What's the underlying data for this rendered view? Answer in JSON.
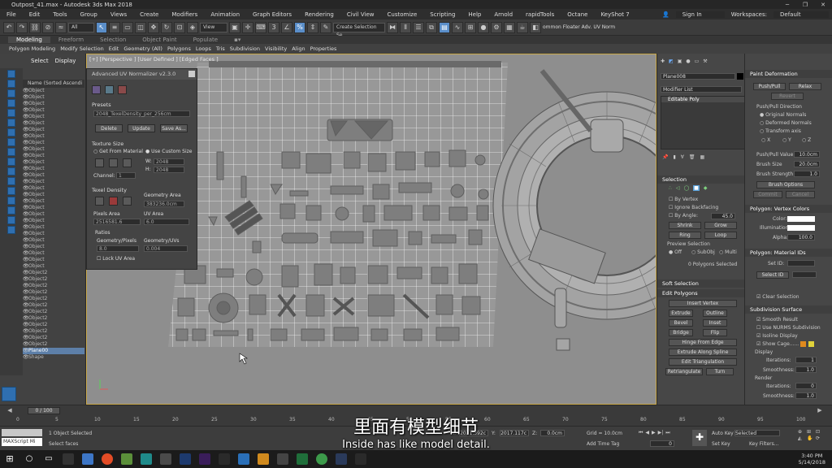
{
  "window": {
    "title": "Outpost_41.max - Autodesk 3ds Max 2018"
  },
  "menu": [
    "File",
    "Edit",
    "Tools",
    "Group",
    "Views",
    "Create",
    "Modifiers",
    "Animation",
    "Graph Editors",
    "Rendering",
    "Civil View",
    "Customize",
    "Scripting",
    "Help",
    "Arnold",
    "rapidTools",
    "Octane",
    "KeyShot 7"
  ],
  "account": {
    "sign_in": "Sign In",
    "workspaces_label": "Workspaces:",
    "workspace": "Default"
  },
  "toolbar": {
    "filter": "All",
    "view": "View",
    "selection_set": "Create Selection Se",
    "floater": "ommon Floater Adv. UV Norm"
  },
  "ribbon": {
    "tabs": [
      "Modeling",
      "Freeform",
      "Selection",
      "Object Paint",
      "Populate"
    ],
    "items": [
      "Polygon Modeling",
      "Modify Selection",
      "Edit",
      "Geometry (All)",
      "Polygons",
      "Loops",
      "Tris",
      "Subdivision",
      "Visibility",
      "Align",
      "Properties"
    ]
  },
  "explorer": {
    "tabs": [
      "Select",
      "Display"
    ],
    "header": "Name (Sorted Ascendi",
    "rows": [
      "Object",
      "Object",
      "Object",
      "Object",
      "Object",
      "Object",
      "Object",
      "Object",
      "Object",
      "Object",
      "Object",
      "Object",
      "Object",
      "Object",
      "Object",
      "Object",
      "Object",
      "Object",
      "Object",
      "Object",
      "Object",
      "Object",
      "Object",
      "Object",
      "Object",
      "Object",
      "Object",
      "Object",
      "Object2",
      "Object2",
      "Object2",
      "Object2",
      "Object2",
      "Object2",
      "Object2",
      "Object2",
      "Object2",
      "Object2",
      "Object2",
      "Object2",
      "Plane00",
      "Shape"
    ],
    "selected_row": "Plane00"
  },
  "viewport": {
    "label": "[+] [Perspective ] [User Defined ] [Edged Faces ]"
  },
  "uvtool": {
    "title": "Advanced UV Normalizer v2.3.0",
    "presets_label": "Presets",
    "preset_value": "2048_TexelDensity_per_256cm",
    "btn_delete": "Delete",
    "btn_update": "Update",
    "btn_saveas": "Save As...",
    "texture_size_label": "Texture Size",
    "get_from_material": "Get From Material",
    "use_custom_size": "Use Custom Size",
    "w_label": "W:",
    "w_value": "2048",
    "h_label": "H:",
    "h_value": "2048",
    "channel_label": "Channel:",
    "channel_value": "1",
    "texel_density_label": "Texel Density",
    "geometry_area_label": "Geometry Area",
    "geometry_area_value": "383236.0cm",
    "pixels_area_label": "Pixels Area",
    "pixels_area_value": "2516581.6",
    "uv_area_label": "UV Area",
    "uv_area_value": "6.0",
    "ratios_label": "Ratios",
    "geo_pixels_label": "Geometry/Pixels",
    "geo_pixels_value": "8.0",
    "geo_uvs_label": "Geometry/UVs",
    "geo_uvs_value": "0.004",
    "lock_uv_area": "Lock UV Area"
  },
  "command_panel": {
    "object_name": "Plane008",
    "modifier_list": "Modifier List",
    "stack_item": "Editable Poly",
    "selection_head": "Selection",
    "by_vertex": "By Vertex",
    "ignore_backfacing": "Ignore Backfacing",
    "by_angle": "By Angle:",
    "by_angle_value": "45.0",
    "shrink": "Shrink",
    "grow": "Grow",
    "ring": "Ring",
    "loop": "Loop",
    "preview_selection": "Preview Selection",
    "off": "Off",
    "subobj": "SubObj",
    "multi": "Multi",
    "polys_selected": "0 Polygons Selected",
    "soft_selection": "Soft Selection",
    "edit_polygons": "Edit Polygons",
    "insert_vertex": "Insert Vertex",
    "extrude": "Extrude",
    "outline": "Outline",
    "bevel": "Bevel",
    "inset": "Inset",
    "bridge": "Bridge",
    "flip": "Flip",
    "hinge_from_edge": "Hinge From Edge",
    "extrude_along_spline": "Extrude Along Spline",
    "edit_triangulation": "Edit Triangulation",
    "retriangulate": "Retriangulate",
    "turn": "Turn"
  },
  "mod_panel": {
    "paint_deformation": "Paint Deformation",
    "push_pull": "Push/Pull",
    "relax": "Relax",
    "revert": "Revert",
    "push_pull_direction": "Push/Pull Direction",
    "original_normals": "Original Normals",
    "deformed_normals": "Deformed Normals",
    "transform_axis": "Transform axis",
    "x": "X",
    "y": "Y",
    "z": "Z",
    "push_pull_value_label": "Push/Pull Value",
    "push_pull_value": "10.0cm",
    "brush_size_label": "Brush Size",
    "brush_size": "20.0cm",
    "brush_strength_label": "Brush Strength",
    "brush_strength": "1.0",
    "brush_options": "Brush Options",
    "commit": "Commit",
    "cancel": "Cancel",
    "vertex_colors_head": "Polygon: Vertex Colors",
    "color_label": "Color:",
    "illumination_label": "Illumination:",
    "alpha_label": "Alpha:",
    "alpha_value": "100.0",
    "material_ids_head": "Polygon: Material IDs",
    "set_id_label": "Set ID:",
    "select_id": "Select ID",
    "clear_selection": "Clear Selection",
    "subdivision_surface": "Subdivision Surface",
    "smooth_result": "Smooth Result",
    "use_nurms": "Use NURMS Subdivision",
    "isoline_display": "Isoline Display",
    "show_cage": "Show Cage......",
    "display_label": "Display",
    "iterations_label": "Iterations:",
    "iterations_value": "1",
    "smoothness_label": "Smoothness:",
    "smoothness_value": "1.0",
    "render_label": "Render",
    "render_iterations_value": "0",
    "render_smoothness_value": "1.0",
    "orange": "#e08a1e",
    "yellow": "#e0d23a"
  },
  "timeline": {
    "slider": "0 / 100",
    "ticks": [
      "0",
      "5",
      "10",
      "15",
      "20",
      "25",
      "30",
      "35",
      "40",
      "45",
      "50",
      "55",
      "60",
      "65",
      "70",
      "75",
      "80",
      "85",
      "90",
      "95",
      "100"
    ]
  },
  "status": {
    "maxscript": "MAXScript Mi",
    "objects_selected": "1 Object Selected",
    "prompt": "Select faces",
    "x_label": "X:",
    "x_value": "2021.392c",
    "y_label": "Y:",
    "y_value": "2017.117c",
    "z_label": "Z:",
    "z_value": "0.0cm",
    "grid": "Grid = 10.0cm",
    "add_time_tag": "Add Time Tag",
    "auto_key": "Auto Key",
    "selected": "Selected",
    "set_key": "Set Key",
    "key_filters": "Key Filters...",
    "frame": "0"
  },
  "subtitle": {
    "cn": "里面有模型细节",
    "en": "Inside has like model detail."
  },
  "taskbar": {
    "time": "3:40 PM",
    "date": "5/14/2018"
  }
}
